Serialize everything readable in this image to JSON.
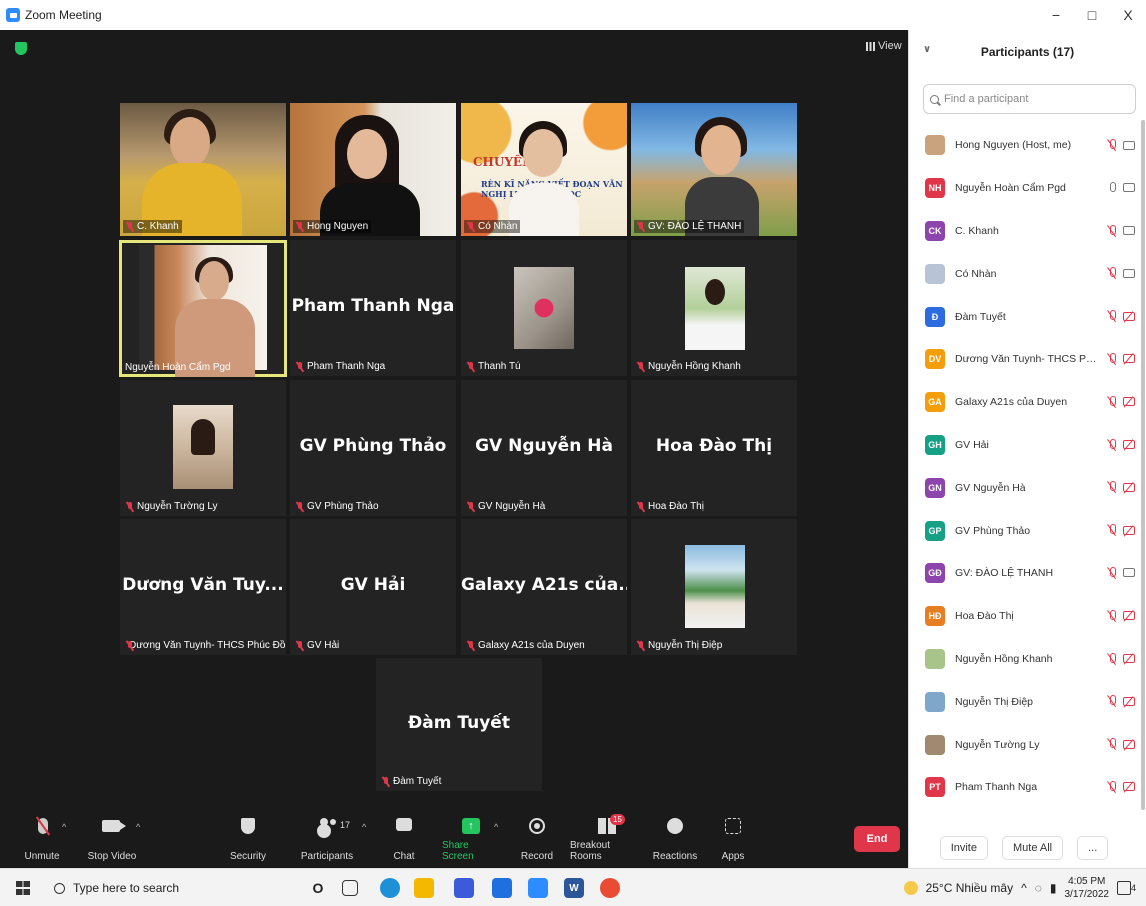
{
  "window": {
    "title": "Zoom Meeting",
    "controls": [
      "−",
      "□",
      "X"
    ]
  },
  "meeting": {
    "view_label": "View",
    "tiles": [
      {
        "name": "C. Khanh",
        "label": "C. Khanh",
        "kind": "video"
      },
      {
        "name": "Hong Nguyen",
        "label": "Hong Nguyen",
        "kind": "video"
      },
      {
        "name": "Có Nhàn",
        "label": "Có Nhàn",
        "kind": "video",
        "slide_text_1": "CHUYÊN ĐỀ",
        "slide_text_2": "RÈN KĨ NĂNG VIẾT ĐOẠN VĂN NGHỊ LUẬN VĂN HỌC"
      },
      {
        "name": "GV: ĐÀO LỆ THANH",
        "label": "GV: ĐÀO LỆ THANH",
        "kind": "video"
      },
      {
        "name": "Nguyễn Hoàn Cẩm Pgd",
        "label": "Nguyễn Hoàn Cẩm Pgd",
        "kind": "video",
        "active": true
      },
      {
        "name": "Pham Thanh Nga",
        "label": "Pham Thanh Nga",
        "kind": "name"
      },
      {
        "name": "Thanh Tú",
        "label": "Thanh Tú",
        "kind": "photo"
      },
      {
        "name": "Nguyễn Hồng Khanh",
        "label": "Nguyễn Hồng Khanh",
        "kind": "photo"
      },
      {
        "name": "Nguyễn Tường Ly",
        "label": "Nguyễn Tường Ly",
        "kind": "photo"
      },
      {
        "name": "GV Phùng Thảo",
        "label": "GV Phùng Thảo",
        "kind": "name"
      },
      {
        "name": "GV Nguyễn Hà",
        "label": "GV Nguyễn Hà",
        "kind": "name"
      },
      {
        "name": "Hoa Đào Thị",
        "label": "Hoa Đào Thị",
        "kind": "name"
      },
      {
        "name": "Dương Văn Tuy...",
        "label": "Dương Văn Tuynh- THCS Phúc Đồ...",
        "kind": "name"
      },
      {
        "name": "GV Hải",
        "label": "GV Hải",
        "kind": "name"
      },
      {
        "name": "Galaxy A21s của...",
        "label": "Galaxy A21s của Duyen",
        "kind": "name"
      },
      {
        "name": "Nguyễn Thị Điệp",
        "label": "Nguyễn Thị Điệp",
        "kind": "photo"
      },
      {
        "name": "Đàm Tuyết",
        "label": "Đàm Tuyết",
        "kind": "name"
      }
    ]
  },
  "toolbar": {
    "unmute": "Unmute",
    "stop_video": "Stop Video",
    "security": "Security",
    "participants": "Participants",
    "participants_count": "17",
    "chat": "Chat",
    "share_screen": "Share Screen",
    "record": "Record",
    "breakout_rooms": "Breakout Rooms",
    "breakout_badge": "15",
    "reactions": "Reactions",
    "apps": "Apps",
    "end": "End"
  },
  "panel": {
    "title": "Participants (17)",
    "search_placeholder": "Find a participant",
    "participants": [
      {
        "initials": "",
        "name": "Hong Nguyen (Host, me)",
        "color": "#c9a27e",
        "photo": true,
        "mic": "muted",
        "cam": "on"
      },
      {
        "initials": "NH",
        "name": "Nguyễn Hoàn Cẩm Pgd",
        "color": "#e0364a",
        "mic": "on",
        "cam": "on"
      },
      {
        "initials": "CK",
        "name": "C. Khanh",
        "color": "#8e44ad",
        "mic": "muted",
        "cam": "on"
      },
      {
        "initials": "",
        "name": "Có Nhàn",
        "color": "#b8c4d6",
        "photo": true,
        "mic": "muted",
        "cam": "on"
      },
      {
        "initials": "Đ",
        "name": "Đàm Tuyết",
        "color": "#2d6cdf",
        "mic": "muted",
        "cam": "off"
      },
      {
        "initials": "DV",
        "name": "Dương Văn Tuynh- THCS Phúc Đ...",
        "color": "#f59e0b",
        "mic": "muted",
        "cam": "off"
      },
      {
        "initials": "GA",
        "name": "Galaxy A21s của Duyen",
        "color": "#f59e0b",
        "mic": "muted",
        "cam": "off"
      },
      {
        "initials": "GH",
        "name": "GV Hải",
        "color": "#16a085",
        "mic": "muted",
        "cam": "off"
      },
      {
        "initials": "GN",
        "name": "GV Nguyễn Hà",
        "color": "#8e44ad",
        "mic": "muted",
        "cam": "off"
      },
      {
        "initials": "GP",
        "name": "GV Phùng Thảo",
        "color": "#16a085",
        "mic": "muted",
        "cam": "off"
      },
      {
        "initials": "GĐ",
        "name": "GV: ĐÀO LỆ THANH",
        "color": "#8e44ad",
        "mic": "muted",
        "cam": "on"
      },
      {
        "initials": "HĐ",
        "name": "Hoa Đào Thị",
        "color": "#e67e22",
        "mic": "muted",
        "cam": "off"
      },
      {
        "initials": "",
        "name": "Nguyễn Hồng Khanh",
        "color": "#a8c48a",
        "photo": true,
        "mic": "muted",
        "cam": "off"
      },
      {
        "initials": "",
        "name": "Nguyễn Thị Điệp",
        "color": "#7fa7c9",
        "photo": true,
        "mic": "muted",
        "cam": "off"
      },
      {
        "initials": "",
        "name": "Nguyễn Tường Ly",
        "color": "#a0896f",
        "photo": true,
        "mic": "muted",
        "cam": "off"
      },
      {
        "initials": "PT",
        "name": "Pham Thanh Nga",
        "color": "#e0364a",
        "mic": "muted",
        "cam": "off"
      }
    ],
    "invite": "Invite",
    "mute_all": "Mute All",
    "more": "..."
  },
  "taskbar": {
    "search_placeholder": "Type here to search",
    "weather": "25°C Nhiều mây",
    "time": "4:05 PM",
    "date": "3/17/2022",
    "notification_count": "4"
  }
}
